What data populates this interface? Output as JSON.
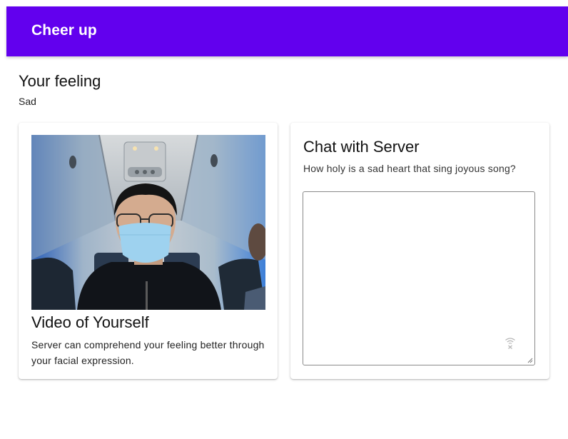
{
  "appbar": {
    "title": "Cheer up",
    "color": "#6200ee"
  },
  "feeling": {
    "heading": "Your feeling",
    "value": "Sad"
  },
  "video_card": {
    "title": "Video of Yourself",
    "description": "Server can comprehend your feeling better through your facial expression."
  },
  "chat_card": {
    "title": "Chat with Server",
    "prompt": "How holy is a sad heart that sing joyous song?",
    "input_value": "",
    "icon": "wifi-off-icon"
  }
}
